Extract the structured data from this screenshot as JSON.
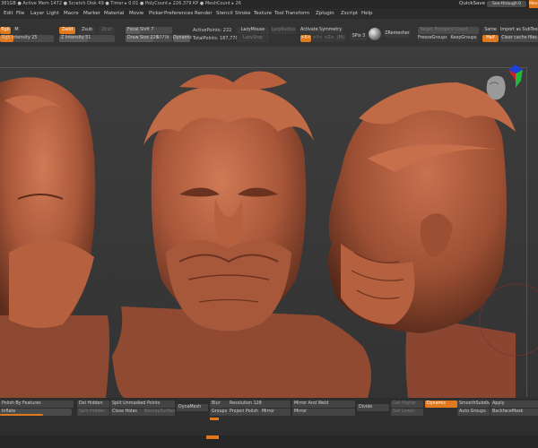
{
  "status": {
    "text": "381GB ● Active Mem 1472 ● Scratch Disk 49 ● Timer ▸ 0.01 ● PolyCount ▸ 226.379 KP ● MeshCount ▸ 26",
    "quicksave": "QuickSave",
    "seethrough": "See-through 0",
    "menus_btn": "Menus"
  },
  "menu": [
    "Edit",
    "File",
    "Layer",
    "Light",
    "Macro",
    "Marker",
    "Material",
    "Movie",
    "Picker",
    "Preferences",
    "Render",
    "Stencil",
    "Stroke",
    "Texture",
    "Tool",
    "Transform",
    "Zplugin",
    "Zscript",
    "Help"
  ],
  "toolbar": {
    "rgb": "Rgb",
    "m": "M",
    "zadd": "Zadd",
    "zsub": "Zsub",
    "zcut": "Zcut",
    "rgb_intensity": "Rgb Intensity 25",
    "z_intensity": "Z Intensity 51",
    "focal_shift": "Focal Shift 7",
    "draw_size": "Draw Size 226",
    "dynamic": "Dynamic",
    "draw_extra": "87774",
    "active_points": "ActivePoints: 222",
    "total_points": "TotalPoints: 187,770",
    "lazymouse": "LazyMouse",
    "lazystep": "LazyStep",
    "lazyradius": "LazyRadius",
    "activate_symmetry": "Activate Symmetry",
    "sym_x": ">X<",
    "sym_y": ">Y<",
    "sym_z": ">Z<",
    "sym_m": "(M)",
    "spix": "SPix 3",
    "zremesher": "ZRemesher",
    "target_polygons": "Target Polygons Count",
    "freeze_groups": "FreezeGroups",
    "keep_groups": "KeepGroups",
    "same": "Same",
    "half": "Half",
    "import_subtool": "Import as SubTool",
    "clear_cache": "Clear cache files"
  },
  "bottom": {
    "polish_features": "Polish By Features",
    "inflate": "Inflate",
    "del_hidden": "Del Hidden",
    "split_hidden": "Split Hidden",
    "split_unmasked": "Split Unmasked Points",
    "close_holes": "Close Holes",
    "resnap": "ResnapSurface",
    "dynamesh": "DynaMesh",
    "blur": "Blur",
    "resolution": "Resolution 128",
    "groups": "Groups",
    "project": "Project",
    "polish": "Polish",
    "mirror": "Mirror",
    "mirror_weld": "Mirror And Weld",
    "mirror2": "Mirror",
    "divide": "Divide",
    "get_higher": "Get Higher",
    "get_lower": "Get Lower",
    "dynamic": "Dynamic",
    "smooth_subdiv": "SmoothSubdiv",
    "auto_groups": "Auto Groups",
    "apply": "Apply",
    "backface": "BackfaceMask"
  },
  "colors": {
    "accent": "#e0781e",
    "clay": "#b5603f",
    "background": "#3a3a3a"
  },
  "icons": [
    "head-navigation-icon",
    "axis-gizmo-icon",
    "material-sphere-icon"
  ]
}
